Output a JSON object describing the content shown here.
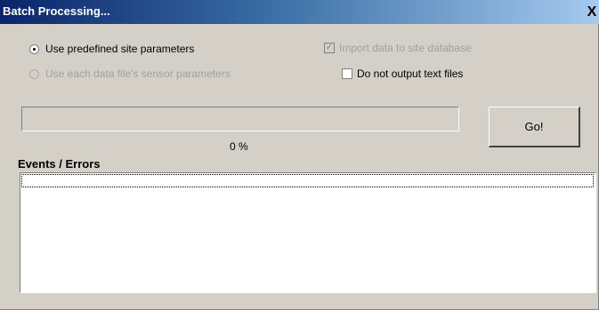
{
  "window": {
    "title": "Batch Processing...",
    "close_label": "X"
  },
  "options": {
    "radio_predefined": {
      "label": "Use predefined site parameters",
      "checked": true,
      "enabled": true
    },
    "radio_sensor": {
      "label": "Use each data file's sensor parameters",
      "checked": false,
      "enabled": false
    },
    "check_import": {
      "label": "Import data to site database",
      "checked": true,
      "enabled": false
    },
    "check_no_text": {
      "label": "Do not output text files",
      "checked": false,
      "enabled": true
    }
  },
  "progress": {
    "percent_text": "0 %",
    "value": 0
  },
  "go_button": {
    "label": "Go!"
  },
  "events": {
    "label": "Events / Errors",
    "items": []
  },
  "colors": {
    "titlebar_start": "#0a246a",
    "titlebar_end": "#a6caf0",
    "dialog_bg": "#d4d0c8"
  }
}
